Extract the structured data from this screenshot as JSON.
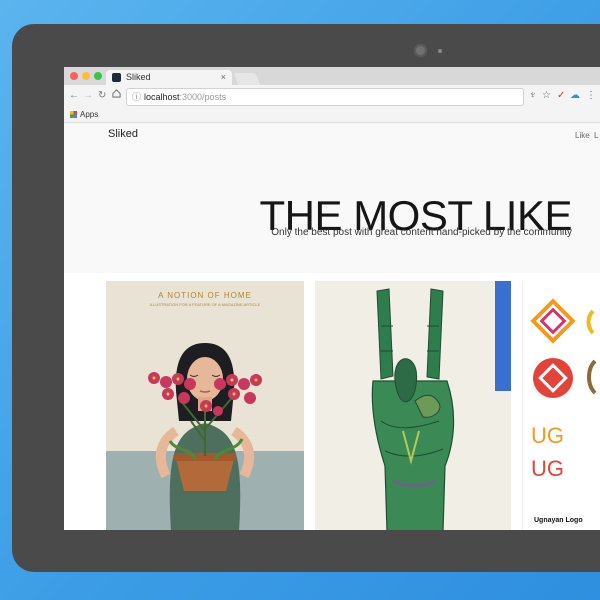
{
  "browser": {
    "tab_title": "Sliked",
    "tab_close": "×",
    "url_host": "localhost",
    "url_path": ":3000/posts",
    "bookmarks": {
      "apps_label": "Apps"
    },
    "nav_icons": [
      "back-icon",
      "forward-icon",
      "reload-icon",
      "home-icon"
    ],
    "toolbar_icons": [
      "info-icon",
      "extension-icon",
      "star-icon",
      "extension-icon",
      "cloud-icon",
      "menu-icon"
    ],
    "window_dot_colors": [
      "#fc605c",
      "#fdbc40",
      "#34c84a"
    ]
  },
  "site": {
    "brand": "Sliked",
    "nav": [
      "Like",
      "L"
    ],
    "headline": "THE MOST LIKE",
    "subheadline": "Only the best post with great content hand-picked by the community"
  },
  "posts": [
    {
      "poster_title": "A NOTION OF HOME",
      "poster_subtitle": "ILLUSTRATION FOR A FEATURE OF A MAGAZINE ARTICLE"
    },
    {
      "image": "green-hand-drawing"
    },
    {
      "title": "Ugnayan Logo",
      "logo_text": "UG"
    }
  ],
  "colors": {
    "accent_orange": "#f39a1e",
    "logo_red": "#e2443a",
    "logo_pink": "#d6336c",
    "logo_yellow": "#f2b81f"
  }
}
